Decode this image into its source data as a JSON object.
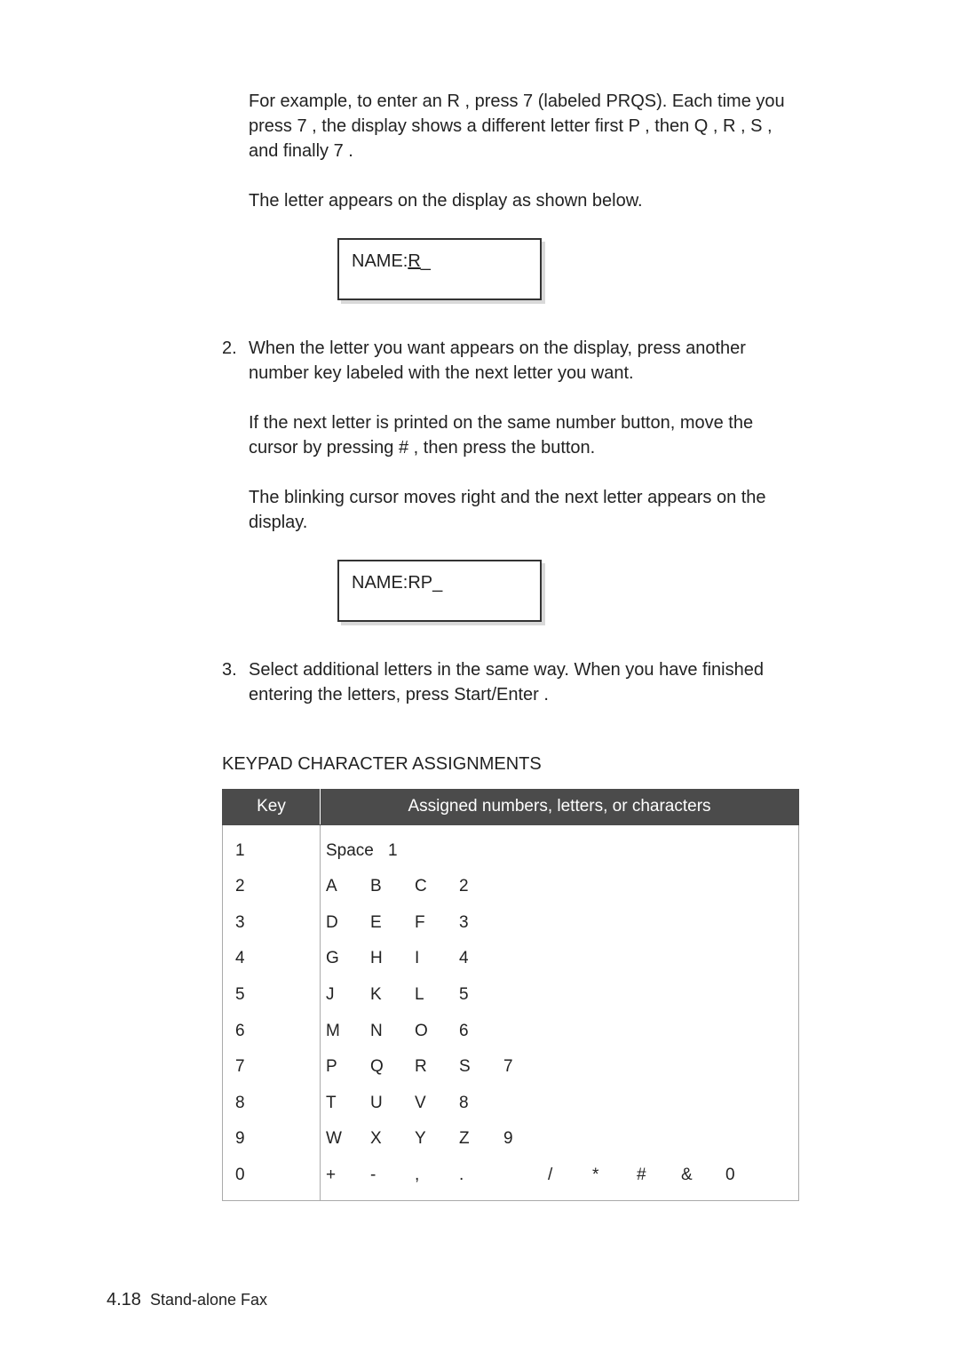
{
  "content": {
    "p1a": "For example, to enter an ",
    "p1b": "R",
    "p1c": " , press ",
    "p1d": "7",
    "p1e": " (labeled PRQS). Each time you press ",
    "p1f": "7",
    "p1g": " , the display shows a different letter first ",
    "p1h": "P",
    "p1i": " , then ",
    "p1j": "Q",
    "p1k": " , ",
    "p1l": "R",
    "p1m": " , ",
    "p1n": "S",
    "p1o": " , and finally ",
    "p1p": "7",
    "p1q": " .",
    "p2": "The letter appears on the display as shown below.",
    "display1_label": "NAME:",
    "display1_value": "R",
    "step2_num": "2.",
    "step2_text": "When the letter you want appears on the display, press another number key labeled with the next letter you want.",
    "step2_sub1a": "If the next letter is printed on the same number button, move the cursor by pressing ",
    "step2_sub1b": "#",
    "step2_sub1c": " , then press the button.",
    "step2_sub2": "The blinking cursor moves right and the next letter appears on the display.",
    "display2_label": "NAME:",
    "display2_value": "RP",
    "step3_num": "3.",
    "step3_a": "Select additional letters in the same way. When you have finished entering the letters, press ",
    "step3_b": "Start/Enter",
    "step3_c": " .",
    "table_title": "KEYPAD CHARACTER ASSIGNMENTS",
    "th_key": "Key",
    "th_assigned": "Assigned numbers, letters, or characters",
    "rows": [
      {
        "key": "1",
        "chars": [
          "Space",
          "1"
        ]
      },
      {
        "key": "2",
        "chars": [
          "A",
          "B",
          "C",
          "2"
        ]
      },
      {
        "key": "3",
        "chars": [
          "D",
          "E",
          "F",
          "3"
        ]
      },
      {
        "key": "4",
        "chars": [
          "G",
          "H",
          "I",
          "4"
        ]
      },
      {
        "key": "5",
        "chars": [
          "J",
          "K",
          "L",
          "5"
        ]
      },
      {
        "key": "6",
        "chars": [
          "M",
          "N",
          "O",
          "6"
        ]
      },
      {
        "key": "7",
        "chars": [
          "P",
          "Q",
          "R",
          "S",
          "7"
        ]
      },
      {
        "key": "8",
        "chars": [
          "T",
          "U",
          "V",
          "8"
        ]
      },
      {
        "key": "9",
        "chars": [
          "W",
          "X",
          "Y",
          "Z",
          "9"
        ]
      },
      {
        "key": "0",
        "chars": [
          "+",
          "-",
          ",",
          ".",
          "",
          "/",
          "*",
          "#",
          "&",
          "0"
        ]
      }
    ],
    "footer_page": "4.18",
    "footer_text": "Stand-alone Fax"
  }
}
